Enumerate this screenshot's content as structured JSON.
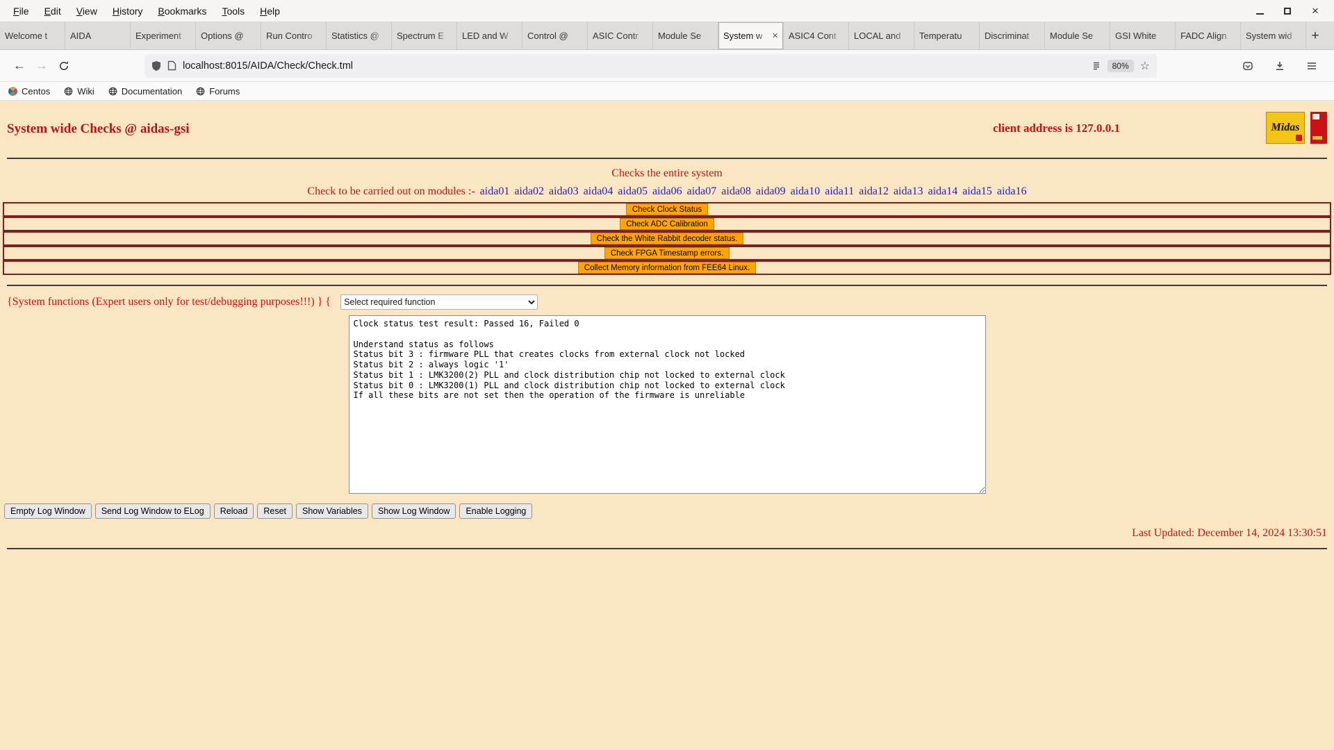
{
  "colors": {
    "page_bg": "#fbe6c3",
    "accent_red": "#cc1111",
    "title_red": "#b01818",
    "link_blue": "#2222bb",
    "button_orange": "#ffa500",
    "row_border": "#7e2020"
  },
  "icons": {
    "close": "×",
    "plus": "+",
    "back": "←",
    "forward": "→",
    "star": "☆"
  },
  "window": {
    "menu_items": [
      "File",
      "Edit",
      "View",
      "History",
      "Bookmarks",
      "Tools",
      "Help"
    ]
  },
  "tabs": [
    {
      "label": "Welcome t"
    },
    {
      "label": "AIDA"
    },
    {
      "label": "Experiment"
    },
    {
      "label": "Options @"
    },
    {
      "label": "Run Contro"
    },
    {
      "label": "Statistics @"
    },
    {
      "label": "Spectrum E"
    },
    {
      "label": "LED and W"
    },
    {
      "label": "Control @"
    },
    {
      "label": "ASIC Contr"
    },
    {
      "label": "Module Se"
    },
    {
      "label": "System w",
      "active": true
    },
    {
      "label": "ASIC4 Cont"
    },
    {
      "label": "LOCAL and"
    },
    {
      "label": "Temperatu"
    },
    {
      "label": "Discriminat"
    },
    {
      "label": "Module Se"
    },
    {
      "label": "GSI White"
    },
    {
      "label": "FADC Align"
    },
    {
      "label": "System wid"
    }
  ],
  "navbar": {
    "url": "localhost:8015/AIDA/Check/Check.tml",
    "zoom": "80%"
  },
  "bookmarks": {
    "centos": "Centos",
    "items": [
      "Wiki",
      "Documentation",
      "Forums"
    ]
  },
  "page": {
    "title": "System wide Checks @ aidas-gsi",
    "client_address": "client address is 127.0.0.1",
    "midas_logo_text": "Midas",
    "subtitle": "Checks the entire system",
    "modules_prefix": "Check to be carried out on modules :-",
    "modules": [
      "aida01",
      "aida02",
      "aida03",
      "aida04",
      "aida05",
      "aida06",
      "aida07",
      "aida08",
      "aida09",
      "aida10",
      "aida11",
      "aida12",
      "aida13",
      "aida14",
      "aida15",
      "aida16"
    ],
    "check_buttons": [
      "Check Clock Status",
      "Check ADC Calibration",
      "Check the White Rabbit decoder status.",
      "Check FPGA Timestamp errors.",
      "Collect Memory information from FEE64 Linux."
    ],
    "expert_label": "{System functions (Expert users only for test/debugging purposes!!!)  } {",
    "function_select": "Select required function",
    "log_text": "Clock status test result: Passed 16, Failed 0\n\nUnderstand status as follows\nStatus bit 3 : firmware PLL that creates clocks from external clock not locked\nStatus bit 2 : always logic '1'\nStatus bit 1 : LMK3200(2) PLL and clock distribution chip not locked to external clock\nStatus bit 0 : LMK3200(1) PLL and clock distribution chip not locked to external clock\nIf all these bits are not set then the operation of the firmware is unreliable",
    "log_buttons": [
      "Empty Log Window",
      "Send Log Window to ELog",
      "Reload",
      "Reset",
      "Show Variables",
      "Show Log Window",
      "Enable Logging"
    ],
    "last_updated": "Last Updated: December 14, 2024 13:30:51"
  }
}
